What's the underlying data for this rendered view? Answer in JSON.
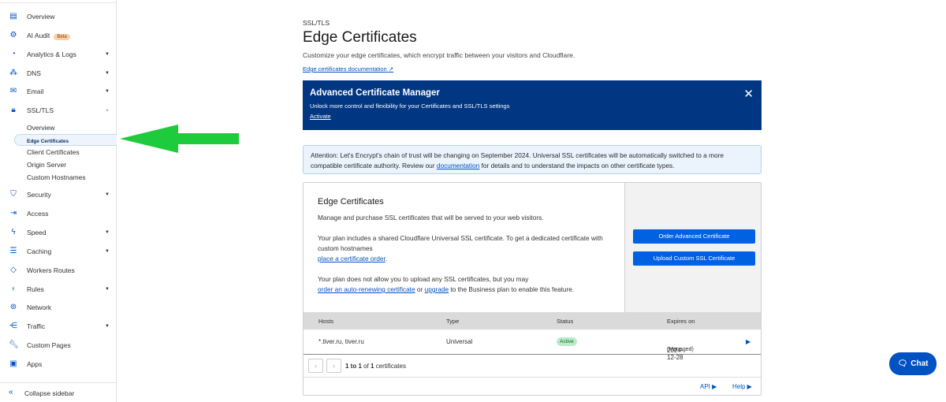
{
  "sidebar": {
    "items": [
      {
        "label": "Overview",
        "icon": "clipboard-icon"
      },
      {
        "label": "AI Audit",
        "icon": "robot-icon",
        "badge": "Beta"
      },
      {
        "label": "Analytics & Logs",
        "icon": "pie-chart-icon"
      },
      {
        "label": "DNS",
        "icon": "network-icon"
      },
      {
        "label": "Email",
        "icon": "email-icon"
      },
      {
        "label": "SSL/TLS",
        "icon": "lock-icon"
      },
      {
        "label": "Security",
        "icon": "shield-icon"
      },
      {
        "label": "Access",
        "icon": "access-icon"
      },
      {
        "label": "Speed",
        "icon": "lightning-icon"
      },
      {
        "label": "Caching",
        "icon": "server-icon"
      },
      {
        "label": "Workers Routes",
        "icon": "workers-icon"
      },
      {
        "label": "Rules",
        "icon": "rules-icon"
      },
      {
        "label": "Network",
        "icon": "location-pin-icon"
      },
      {
        "label": "Traffic",
        "icon": "traffic-icon"
      },
      {
        "label": "Custom Pages",
        "icon": "wrench-icon"
      },
      {
        "label": "Apps",
        "icon": "apps-icon"
      }
    ],
    "ssl_sub": [
      "Overview",
      "Edge Certificates",
      "Client Certificates",
      "Origin Server",
      "Custom Hostnames"
    ],
    "collapse": "Collapse sidebar"
  },
  "header": {
    "crumb": "SSL/TLS",
    "title": "Edge Certificates",
    "description": "Customize your edge certificates, which encrypt traffic between your visitors and Cloudflare.",
    "doc_link": "Edge certificates documentation"
  },
  "banner": {
    "title": "Advanced Certificate Manager",
    "text": "Unlock more control and flexibility for your Certificates and SSL/TLS settings",
    "action": "Activate"
  },
  "attention": {
    "text1": "Attention: Let's Encrypt's chain of trust will be changing on September 2024. Universal SSL certificates will be automatically switched to a more compatible certificate authority. Review our ",
    "link": "documentation",
    "text2": " for details and to understand the impacts on other certificate types."
  },
  "card": {
    "title": "Edge Certificates",
    "p1": "Manage and purchase SSL certificates that will be served to your web visitors.",
    "p2": "Your plan includes a shared Cloudflare Universal SSL certificate. To get a dedicated certificate with custom hostnames",
    "p2_link": "place a certificate order",
    "p3": "Your plan does not allow you to upload any SSL certificates, but you may",
    "p3_link1": "order an auto-renewing certificate",
    "p3_or": " or ",
    "p3_link2": "upgrade",
    "p3_end": " to the Business plan to enable this feature.",
    "btn_order": "Order Advanced Certificate",
    "btn_upload": "Upload Custom SSL Certificate"
  },
  "table": {
    "headers": [
      "Hosts",
      "Type",
      "Status",
      "Expires on"
    ],
    "rows": [
      {
        "hosts": "*.tiver.ru, tiver.ru",
        "type": "Universal",
        "status": "Active",
        "expires": "2024-12-28",
        "managed": "(Managed)"
      }
    ],
    "pager": {
      "from": "1 to 1",
      "of": " of ",
      "total": "1",
      "suffix": " certificates"
    }
  },
  "footer": {
    "api": "API",
    "help": "Help"
  },
  "chat": "Chat",
  "colors": {
    "accent": "#0051c3",
    "banner": "#003682",
    "arrow": "#1ecb3c"
  }
}
